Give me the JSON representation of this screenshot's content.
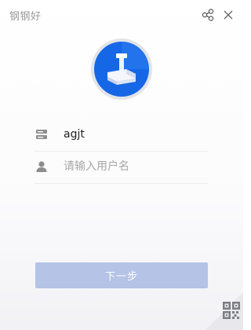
{
  "window": {
    "title": "钢钢好"
  },
  "form": {
    "account_value": "agjt",
    "username_placeholder": "请输入用户名"
  },
  "actions": {
    "next_label": "下一步"
  },
  "icons": {
    "share": "share-icon",
    "close": "close-icon",
    "logo": "steel-rail-logo",
    "account": "server-icon",
    "user": "user-icon",
    "qr": "qr-code-icon"
  },
  "colors": {
    "accent": "#1565e8",
    "button_disabled": "#b4c3e6",
    "text_muted": "#9a9a9a"
  }
}
